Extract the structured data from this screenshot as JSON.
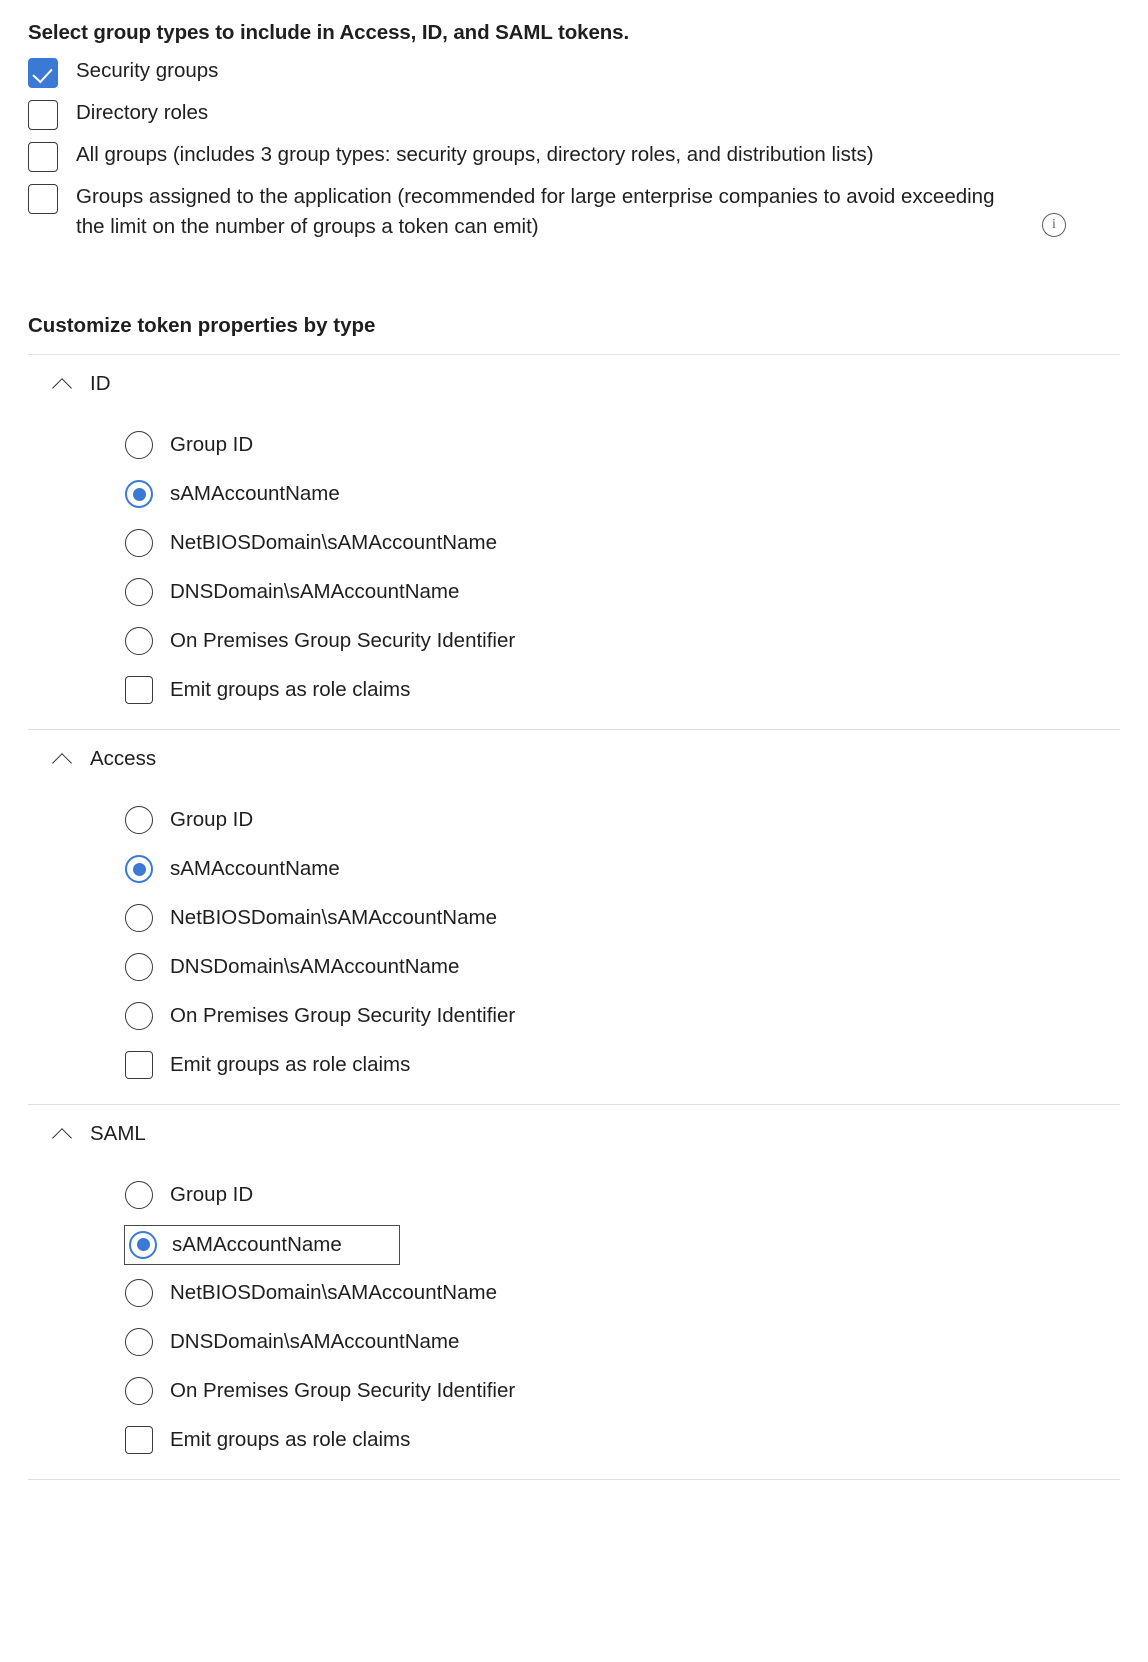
{
  "group_types": {
    "heading": "Select group types to include in Access, ID, and SAML tokens.",
    "options": [
      {
        "label": "Security groups",
        "checked": true,
        "has_info": false
      },
      {
        "label": "Directory roles",
        "checked": false,
        "has_info": false
      },
      {
        "label": "All groups (includes 3 group types: security groups, directory roles, and distribution lists)",
        "checked": false,
        "has_info": false
      },
      {
        "label": "Groups assigned to the application (recommended for large enterprise companies to avoid exceeding the limit on the number of groups a token can emit)",
        "checked": false,
        "has_info": true
      }
    ]
  },
  "customize": {
    "title": "Customize token properties by type",
    "groups": [
      {
        "name": "ID",
        "expanded": true,
        "chevron": "chevron-up-icon",
        "options": [
          {
            "label": "Group ID",
            "type": "radio",
            "selected": false,
            "focused": false
          },
          {
            "label": "sAMAccountName",
            "type": "radio",
            "selected": true,
            "focused": false
          },
          {
            "label": "NetBIOSDomain\\sAMAccountName",
            "type": "radio",
            "selected": false,
            "focused": false
          },
          {
            "label": "DNSDomain\\sAMAccountName",
            "type": "radio",
            "selected": false,
            "focused": false
          },
          {
            "label": "On Premises Group Security Identifier",
            "type": "radio",
            "selected": false,
            "focused": false
          },
          {
            "label": "Emit groups as role claims",
            "type": "checkbox",
            "selected": false,
            "focused": false
          }
        ]
      },
      {
        "name": "Access",
        "expanded": true,
        "chevron": "chevron-up-icon",
        "options": [
          {
            "label": "Group ID",
            "type": "radio",
            "selected": false,
            "focused": false
          },
          {
            "label": "sAMAccountName",
            "type": "radio",
            "selected": true,
            "focused": false
          },
          {
            "label": "NetBIOSDomain\\sAMAccountName",
            "type": "radio",
            "selected": false,
            "focused": false
          },
          {
            "label": "DNSDomain\\sAMAccountName",
            "type": "radio",
            "selected": false,
            "focused": false
          },
          {
            "label": "On Premises Group Security Identifier",
            "type": "radio",
            "selected": false,
            "focused": false
          },
          {
            "label": "Emit groups as role claims",
            "type": "checkbox",
            "selected": false,
            "focused": false
          }
        ]
      },
      {
        "name": "SAML",
        "expanded": true,
        "chevron": "chevron-up-icon",
        "options": [
          {
            "label": "Group ID",
            "type": "radio",
            "selected": false,
            "focused": false
          },
          {
            "label": "sAMAccountName",
            "type": "radio",
            "selected": true,
            "focused": true
          },
          {
            "label": "NetBIOSDomain\\sAMAccountName",
            "type": "radio",
            "selected": false,
            "focused": false
          },
          {
            "label": "DNSDomain\\sAMAccountName",
            "type": "radio",
            "selected": false,
            "focused": false
          },
          {
            "label": "On Premises Group Security Identifier",
            "type": "radio",
            "selected": false,
            "focused": false
          },
          {
            "label": "Emit groups as role claims",
            "type": "checkbox",
            "selected": false,
            "focused": false
          }
        ]
      }
    ]
  },
  "icons": {
    "info": "info-icon",
    "info_glyph": "i"
  },
  "colors": {
    "accent": "#3a7ad4",
    "text": "#201f1e",
    "divider": "#e1dfdd",
    "control_border": "#3b3a39",
    "focus_outline": "#4b4a49"
  }
}
